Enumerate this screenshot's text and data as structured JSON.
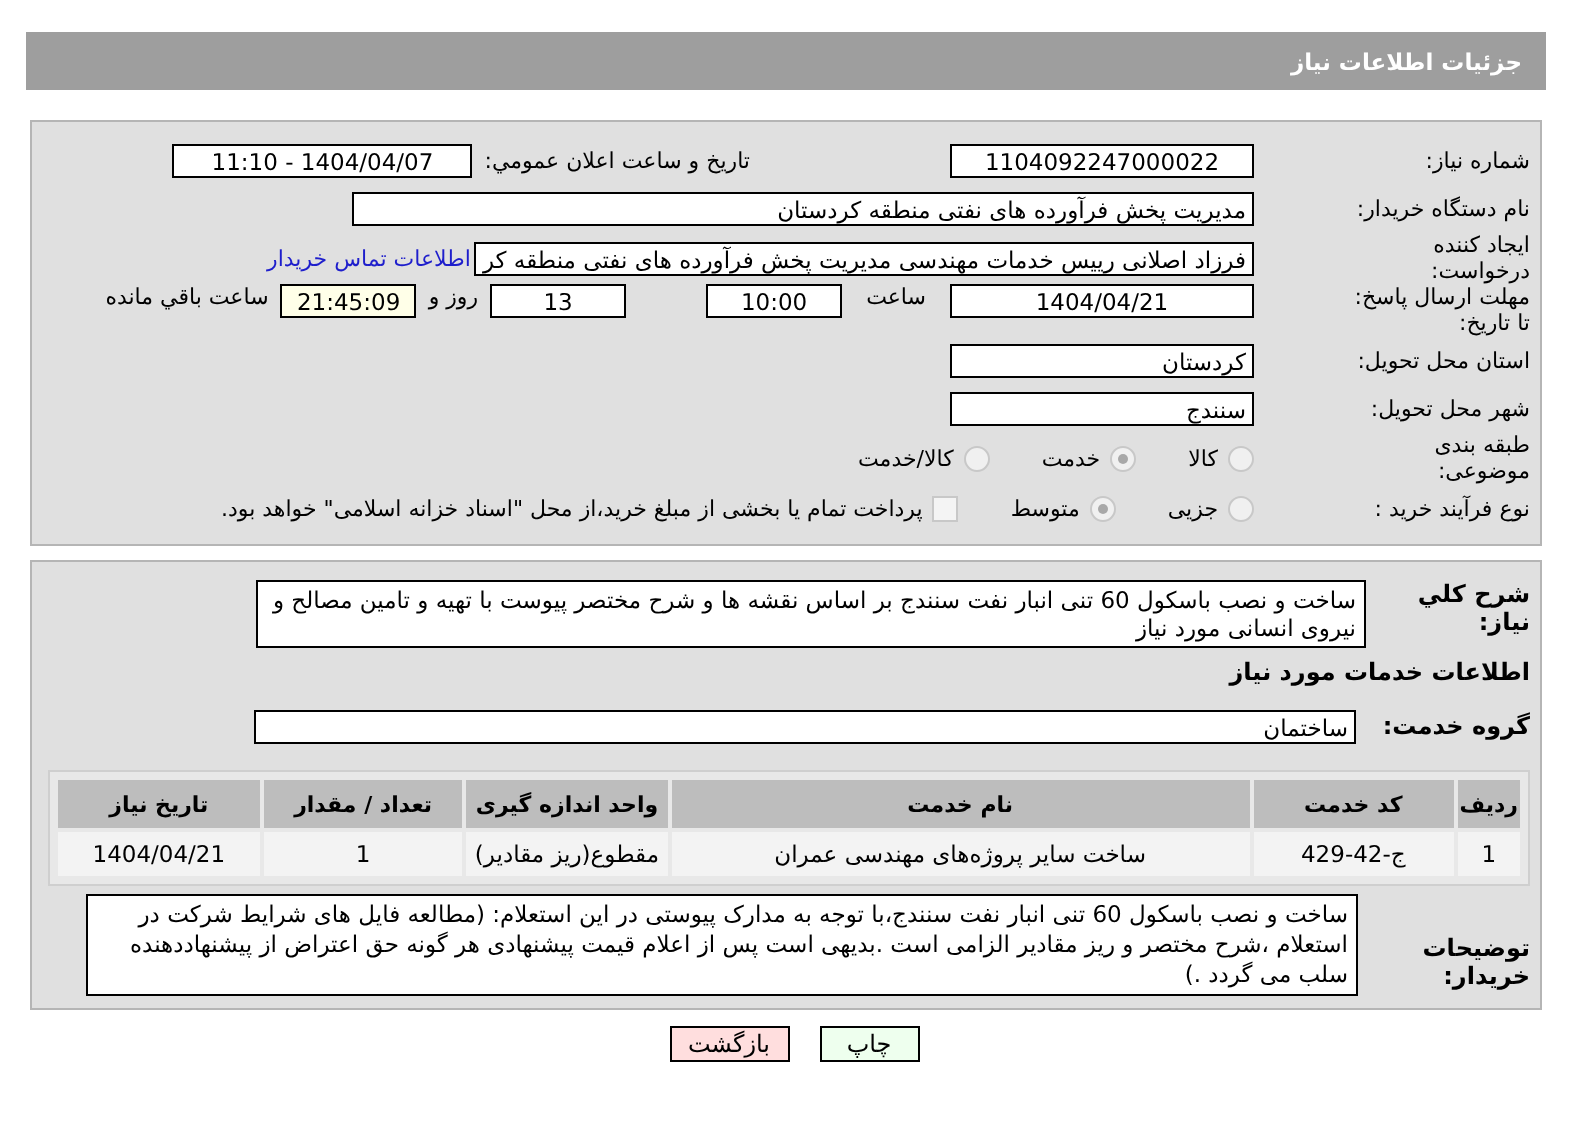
{
  "header": {
    "title": "جزئیات اطلاعات نیاز"
  },
  "details": {
    "need_number": {
      "label": "شماره نیاز:",
      "value": "1104092247000022"
    },
    "announce": {
      "label": "تاریخ و ساعت اعلان عمومي:",
      "value": "1404/04/07 - 11:10"
    },
    "buyer": {
      "label": "نام دستگاه خریدار:",
      "value": "مدیریت پخش فرآورده های نفتی منطقه کردستان"
    },
    "requester": {
      "label": "ایجاد کننده درخواست:",
      "value": "فرزاد اصلانی رییس خدمات مهندسی مدیریت پخش فرآورده های نفتی منطقه کر",
      "contact_link": "اطلاعات تماس خریدار"
    },
    "deadline": {
      "label": "مهلت ارسال پاسخ: تا تاریخ:",
      "date": "1404/04/21",
      "time_label": "ساعت",
      "time": "10:00",
      "days": "13",
      "days_label": "روز و",
      "remaining": "21:45:09",
      "remaining_label": "ساعت باقي مانده"
    },
    "province": {
      "label": "استان محل تحویل:",
      "value": "کردستان"
    },
    "city": {
      "label": "شهر محل تحویل:",
      "value": "سنندج"
    },
    "category": {
      "label": "طبقه بندی موضوعی:",
      "options": [
        {
          "label": "کالا",
          "selected": false
        },
        {
          "label": "خدمت",
          "selected": true
        },
        {
          "label": "کالا/خدمت",
          "selected": false
        }
      ]
    },
    "process": {
      "label": "نوع فرآیند خرید :",
      "options": [
        {
          "label": "جزیی",
          "selected": false
        },
        {
          "label": "متوسط",
          "selected": true
        }
      ],
      "payment": {
        "label": "پرداخت تمام یا بخشی از مبلغ خرید،از محل \"اسناد خزانه اسلامی\" خواهد بود.",
        "checked": false
      }
    }
  },
  "description": {
    "label": "شرح کلي نیاز:",
    "value": "ساخت و نصب باسکول 60 تنی انبار نفت سنندج بر اساس نقشه ها و شرح مختصر پیوست با تهیه و تامین مصالح و نیروی انسانی مورد نیاز"
  },
  "services_heading": "اطلاعات خدمات مورد نیاز",
  "service_group": {
    "label": "گروه خدمت:",
    "value": "ساختمان"
  },
  "table": {
    "columns": [
      "ردیف",
      "کد خدمت",
      "نام خدمت",
      "واحد اندازه گیری",
      "تعداد / مقدار",
      "تاریخ نیاز"
    ],
    "rows": [
      [
        "1",
        "ج-42-429",
        "ساخت سایر پروژه‌های مهندسی عمران",
        "مقطوع(ریز مقادیر)",
        "1",
        "1404/04/21"
      ]
    ]
  },
  "buyer_notes": {
    "label": "توضیحات خریدار:",
    "value": "ساخت و نصب باسکول 60 تنی انبار نفت سنندج،با توجه به مدارک پیوستی در این استعلام: (مطالعه فایل های شرایط شرکت در استعلام ،شرح مختصر و ریز مقادیر  الزامی است .بدیهی است پس از اعلام قیمت پیشنهادی هر گونه حق اعتراض از پیشنهاددهنده سلب می گردد .)"
  },
  "buttons": [
    {
      "label": "چاپ",
      "kind": "print"
    },
    {
      "label": "بازگشت",
      "kind": "back"
    }
  ]
}
